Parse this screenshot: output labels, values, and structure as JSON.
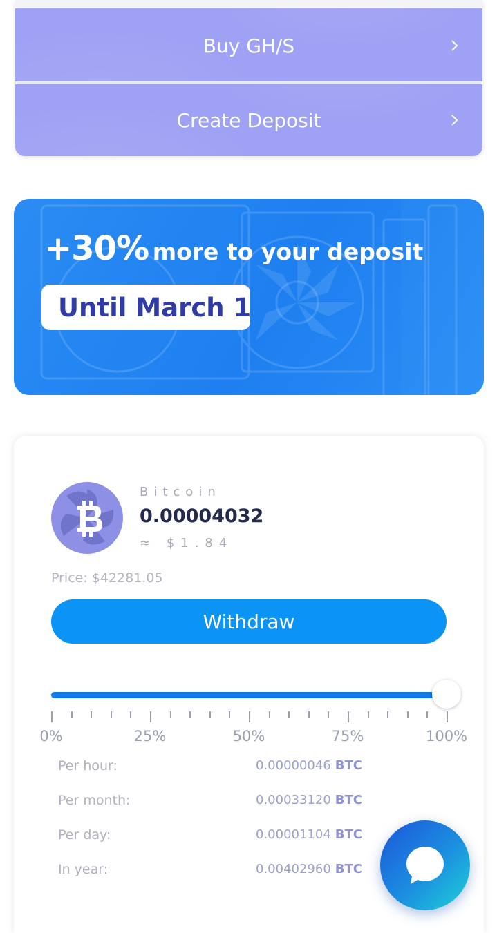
{
  "menu": {
    "items": [
      {
        "label": "Buy GH/S",
        "icon": "chevron-right-icon"
      },
      {
        "label": "Create Deposit",
        "icon": "chevron-right-icon"
      }
    ]
  },
  "promo": {
    "highlight": "+30%",
    "text": "more to your deposit",
    "pill": "Until March 1"
  },
  "wallet": {
    "coin_name": "Bitcoin",
    "coin_icon": "bitcoin-icon",
    "amount": "0.00004032",
    "fiat": "≈ $1.84",
    "price": "Price: $42281.05",
    "withdraw_label": "Withdraw",
    "slider": {
      "value_fraction": 1.0,
      "tick_labels": [
        "0%",
        "25%",
        "50%",
        "75%",
        "100%"
      ]
    },
    "stats": [
      {
        "label": "Per hour:",
        "value": "0.00000046",
        "unit": "BTC"
      },
      {
        "label": "Per month:",
        "value": "0.00033120",
        "unit": "BTC"
      },
      {
        "label": "Per day:",
        "value": "0.00001104",
        "unit": "BTC"
      },
      {
        "label": "In year:",
        "value": "0.00402960",
        "unit": "BTC"
      }
    ]
  },
  "chat": {
    "icon": "chat-bubble-icon"
  },
  "colors": {
    "menu_purple": "#9fa1f4",
    "promo_blue": "#1e7ff0",
    "accent_blue": "#0b93f6",
    "text_dark": "#242a4d"
  }
}
